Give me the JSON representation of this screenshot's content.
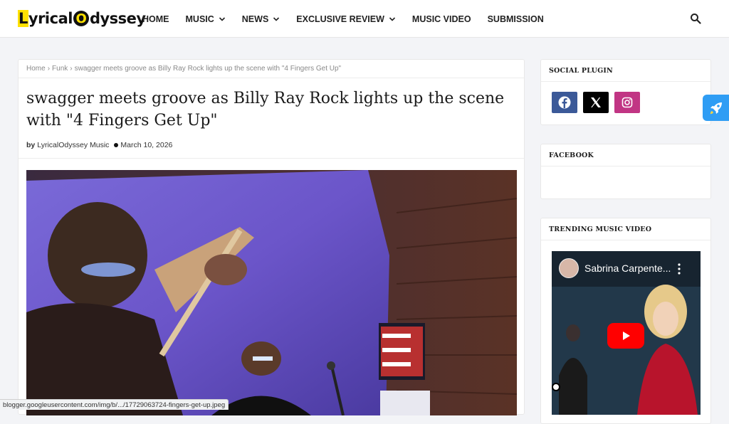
{
  "site": {
    "logo_first": "L",
    "logo_mid": "yrical",
    "logo_o": "O",
    "logo_end": "dyssey"
  },
  "nav": {
    "items": [
      {
        "label": "HOME",
        "dropdown": false
      },
      {
        "label": "MUSIC",
        "dropdown": true
      },
      {
        "label": "NEWS",
        "dropdown": true
      },
      {
        "label": "EXCLUSIVE REVIEW",
        "dropdown": true
      },
      {
        "label": "MUSIC VIDEO",
        "dropdown": false
      },
      {
        "label": "SUBMISSION",
        "dropdown": false
      }
    ],
    "search_icon": "search-icon"
  },
  "breadcrumb": {
    "home": "Home",
    "sep": "›",
    "category": "Funk",
    "current": "swagger meets groove as Billy Ray Rock lights up the scene with \"4 Fingers Get Up\""
  },
  "post": {
    "title": "swagger meets groove as Billy Ray Rock lights up the scene with \"4 Fingers Get Up\"",
    "by_label": "by",
    "author": "LyricalOdyssey Music",
    "date": "March 10, 2026"
  },
  "sidebar": {
    "social_title": "SOCIAL PLUGIN",
    "social": [
      {
        "icon": "facebook-icon",
        "color": "#3b5998"
      },
      {
        "icon": "x-icon",
        "color": "#000000"
      },
      {
        "icon": "instagram-icon",
        "color": "#c13584"
      }
    ],
    "facebook_title": "FACEBOOK",
    "trending_title": "TRENDING MUSIC VIDEO",
    "video_title": "Sabrina Carpente..."
  },
  "status_url": "blogger.googleusercontent.com/img/b/.../17729063724-fingers-get-up.jpeg",
  "colors": {
    "accent_yellow": "#ffe100",
    "rocket_blue": "#2f9df4",
    "youtube_red": "#ff0000"
  }
}
